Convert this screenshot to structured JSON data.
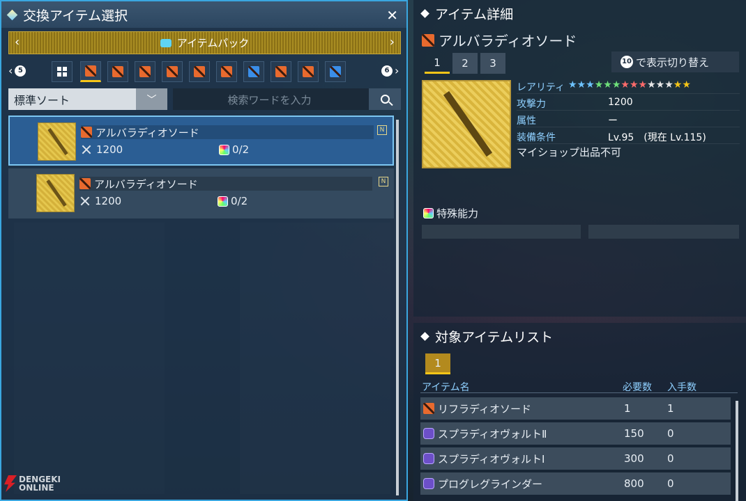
{
  "left_panel": {
    "title": "交換アイテム選択",
    "close": "✕",
    "pack_label": "アイテムパック",
    "nav_left_key": "5",
    "nav_right_key": "6",
    "sort_value": "標準ソート",
    "search_placeholder": "検索ワードを入力",
    "items": [
      {
        "name": "アルバラディオソード",
        "attack": "1200",
        "slots": "0/2",
        "selected": true
      },
      {
        "name": "アルバラディオソード",
        "attack": "1200",
        "slots": "0/2",
        "selected": false
      }
    ]
  },
  "detail": {
    "title": "アイテム詳細",
    "item_name": "アルバラディオソード",
    "tabs": [
      "1",
      "2",
      "3"
    ],
    "toggle_key": "10",
    "toggle_label": "で表示切り替え",
    "rarity_label": "レアリティ",
    "attack_label": "攻撃力",
    "attack_value": "1200",
    "attribute_label": "属性",
    "attribute_value": "ー",
    "requirement_label": "装備条件",
    "requirement_value": "Lv.95　(現在 Lv.115)",
    "note": "マイショップ出品不可",
    "special_label": "特殊能力"
  },
  "target_list": {
    "title": "対象アイテムリスト",
    "page": "1",
    "col_name": "アイテム名",
    "col_required": "必要数",
    "col_obtained": "入手数",
    "rows": [
      {
        "name": "リフラディオソード",
        "required": "1",
        "obtained": "1",
        "icon": "weapon"
      },
      {
        "name": "スプラディオヴォルトⅡ",
        "required": "150",
        "obtained": "0",
        "icon": "gem"
      },
      {
        "name": "スプラディオヴォルトⅠ",
        "required": "300",
        "obtained": "0",
        "icon": "gem"
      },
      {
        "name": "プログレグラインダー",
        "required": "800",
        "obtained": "0",
        "icon": "gem"
      }
    ]
  },
  "watermark": {
    "line1": "DENGEKI",
    "line2": "ONLINE"
  },
  "colors": {
    "accent": "#3aa7e0",
    "gold": "#f5c518",
    "weapon_orange": "#e86a2e"
  }
}
